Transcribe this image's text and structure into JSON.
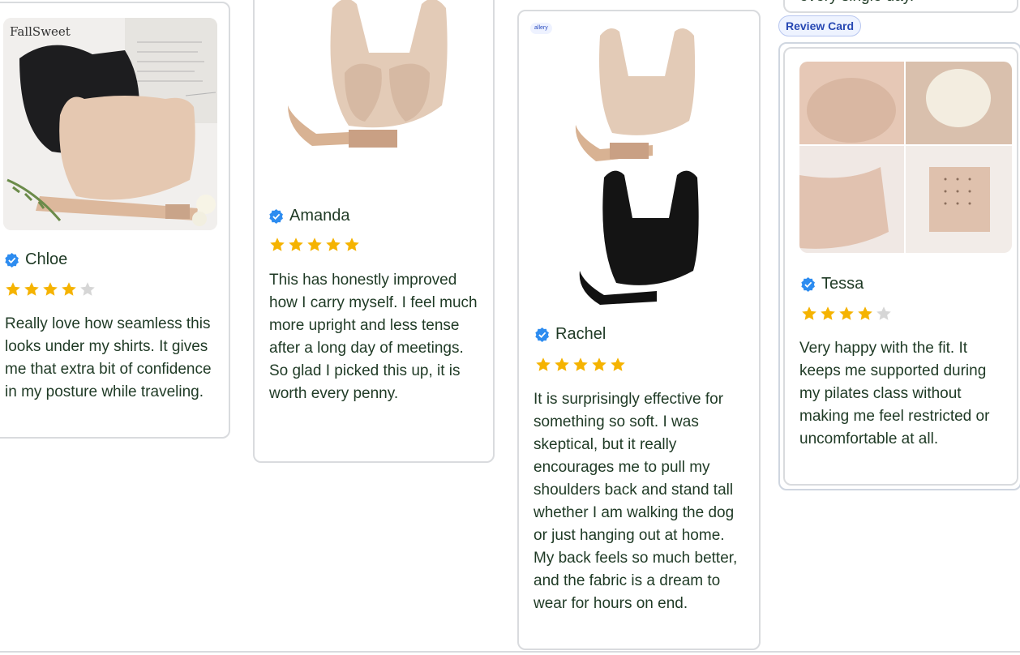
{
  "cards": {
    "chloe": {
      "brand_logo": "FallSweet",
      "name": "Chloe",
      "rating": 4,
      "text": "Really love how seamless this looks under my shirts. It gives me that extra bit of confidence in my posture while traveling."
    },
    "amanda": {
      "name": "Amanda",
      "rating": 5,
      "text": "This has honestly improved how I carry myself. I feel much more upright and less tense after a long day of meetings. So glad I picked this up, it is worth every penny."
    },
    "rachel": {
      "gallery_tag": "allery",
      "name": "Rachel",
      "rating": 5,
      "text": "It is surprisingly effective for something so soft. I was skeptical, but it really encourages me to pull my shoulders back and stand tall whether I am walking the dog or just hanging out at home. My back feels so much better, and the fabric is a dream to wear for hours on end."
    },
    "top_right_snippet": "every single day.",
    "review_card_tag": "Review Card",
    "tessa": {
      "name": "Tessa",
      "rating": 4,
      "text": "Very happy with the fit. It keeps me supported during my pilates class without making me feel restricted or uncomfortable at all."
    }
  },
  "colors": {
    "star_filled": "#f5b301",
    "star_empty": "#d6d6d6",
    "verified": "#2d8cf0",
    "text": "#1f3a25",
    "border": "#d9dbde"
  }
}
